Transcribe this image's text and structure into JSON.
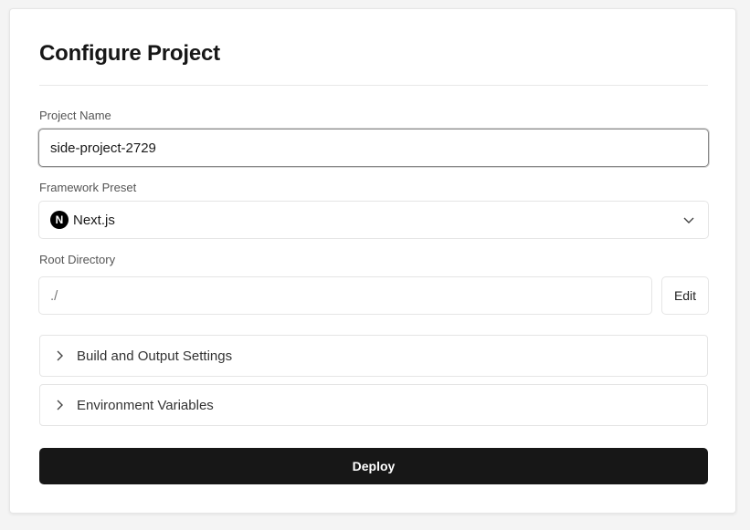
{
  "title": "Configure Project",
  "project_name": {
    "label": "Project Name",
    "value": "side-project-2729"
  },
  "framework_preset": {
    "label": "Framework Preset",
    "selected": "Next.js",
    "logo_letter": "N"
  },
  "root_directory": {
    "label": "Root Directory",
    "value": "./",
    "edit_label": "Edit"
  },
  "sections": [
    {
      "label": "Build and Output Settings",
      "icon": "chevron-right-icon"
    },
    {
      "label": "Environment Variables",
      "icon": "chevron-right-icon"
    }
  ],
  "deploy_label": "Deploy",
  "colors": {
    "primary_button": "#171717",
    "background": "#f4f4f4",
    "card": "#ffffff"
  }
}
